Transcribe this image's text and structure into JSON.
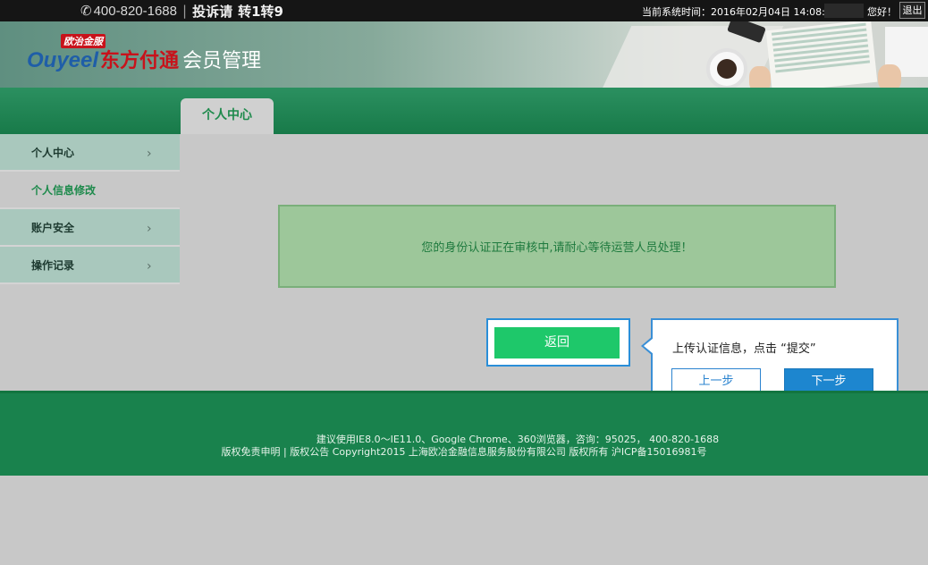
{
  "topbar": {
    "phone": "400-820-1688",
    "separator": "|",
    "complain": "投诉请",
    "complain_ext": "转1转9",
    "system_time": "当前系统时间：2016年02月04日 14:08:17",
    "greeting": "您好！",
    "logout": "退出"
  },
  "header": {
    "badge": "欧治金服",
    "brand_en": "Ouyeel",
    "brand_cn": "东方付通",
    "title": "会员管理"
  },
  "nav": {
    "active_tab": "个人中心"
  },
  "sidebar": {
    "items": [
      {
        "label": "个人中心"
      },
      {
        "label": "个人信息修改"
      },
      {
        "label": "账户安全"
      },
      {
        "label": "操作记录"
      }
    ]
  },
  "main": {
    "notice": "您的身份认证正在审核中,请耐心等待运营人员处理！",
    "return_label": "返回"
  },
  "tooltip": {
    "text": "上传认证信息，点击 “提交”",
    "prev_label": "上一步",
    "next_label": "下一步"
  },
  "footer": {
    "line1": "建议使用IE8.0～IE11.0、Google Chrome、360浏览器，咨询：95025，  400-820-1688",
    "line2": "版权免责申明 | 版权公告 Copyright2015 上海欧冶金融信息服务股份有限公司 版权所有 沪ICP备15016981号"
  },
  "colors": {
    "nav_green": "#187a49",
    "notice_bg": "#9dc79a",
    "return_btn": "#1ec86a",
    "next_btn": "#1d86cf",
    "highlight_border": "#2a8ed8"
  }
}
